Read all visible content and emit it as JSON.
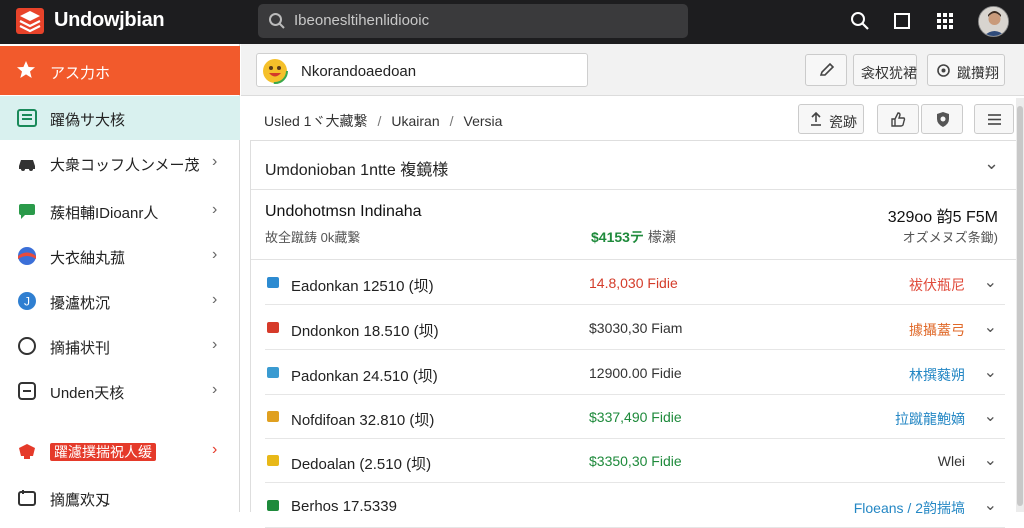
{
  "app": {
    "title": "Undowjbian"
  },
  "search": {
    "value": "Ibeonesltihenlidiooic"
  },
  "sidebar": {
    "header_label": "アス力ホ",
    "items": [
      {
        "label": "躍偽サ大核",
        "icon": "list-icon",
        "active": true
      },
      {
        "label": "大衆コッフ人ンメー茂",
        "icon": "car-icon"
      },
      {
        "label": "蔟相輔IDioanr人",
        "icon": "chat-icon"
      },
      {
        "label": "大衣紬丸菰",
        "icon": "globe-icon"
      },
      {
        "label": "擾瀘枕沉",
        "icon": "info-icon"
      },
      {
        "label": "摘捕状刊",
        "icon": "circle-icon"
      },
      {
        "label": "Unden天核",
        "icon": "plus-box-icon"
      },
      {
        "label": "躍濾撲揣祝人缓",
        "icon": "bell-icon",
        "badge": true
      },
      {
        "label": "摘鷹欢刄",
        "icon": "folder-icon"
      }
    ]
  },
  "toolbar": {
    "workspace": "Nkorandoaedoan",
    "edit_label": "",
    "share_label": "衾权犹裙",
    "settings_label": "蹴攢翔",
    "export_label": "瓷跡"
  },
  "breadcrumb": {
    "items": [
      "Usled 1ヾ大藏繋",
      "Ukairan",
      "Versia"
    ]
  },
  "card": {
    "title": "Umdonioban 1ntte 複鏡様",
    "summary": {
      "name": "Undohotmsn Indinaha",
      "sub": "故全蹴鋳 0k藏繋",
      "amount": "$4153テ",
      "amount_suffix": "檬瀬",
      "right_top": "329oo 韵5 F5M",
      "right_bottom": "オズメヌズ条鋤)"
    },
    "rows": [
      {
        "name": "Eadonkan 12510 (坝)",
        "amount": "14.8,030 Fidie",
        "amount_color": "#d43c2a",
        "status": "祓伏瓶尼",
        "status_color": "#e04a3a",
        "icon_color": "#2d8bd1"
      },
      {
        "name": "Dndonkon 18.510 (坝)",
        "amount": "$3030,30 Fiam",
        "amount_color": "#333333",
        "status": "據攝蓋弓",
        "status_color": "#e06a2a",
        "icon_color": "#d63a2a"
      },
      {
        "name": "Padonkan 24.510 (坝)",
        "amount": "12900.00 Fidie",
        "amount_color": "#333333",
        "status": "林撰蕤朔",
        "status_color": "#2487c4",
        "icon_color": "#3a9bd1"
      },
      {
        "name": "Nofdifoan 32.810 (坝)",
        "amount": "$337,490 Fidie",
        "amount_color": "#1e8a3b",
        "status": "拉蹴龍鮑嫡",
        "status_color": "#2487c4",
        "icon_color": "#e0a020"
      },
      {
        "name": "Dedoalan (2.510 (坝)",
        "amount": "$3350,30 Fidie",
        "amount_color": "#1e8a3b",
        "status": "Wlei",
        "status_color": "#333333",
        "icon_color": "#e8b818"
      },
      {
        "name": "Berhos 17.5339",
        "amount": "",
        "amount_color": "#333333",
        "status": "Floeans / 2韵揣塙",
        "status_color": "#2487c4",
        "icon_color": "#1e8a3b"
      }
    ]
  },
  "colors": {
    "accent": "#f25a2c",
    "active_bg": "#d9f1ef",
    "topbar": "#1d1d1f"
  }
}
